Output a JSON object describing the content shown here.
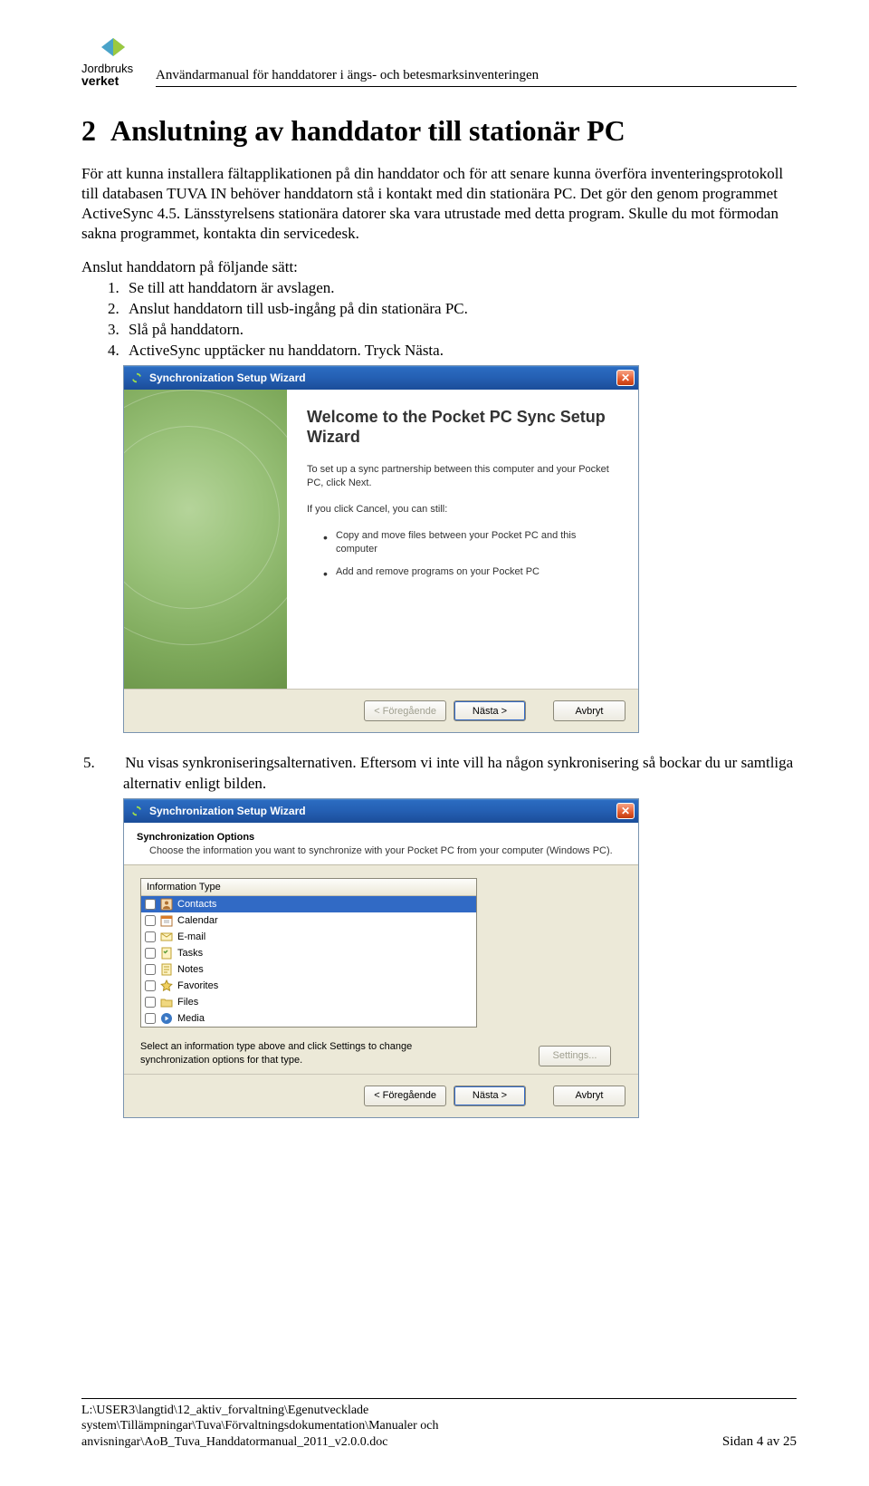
{
  "header": {
    "logo_top": "Jordbruks",
    "logo_bottom": "verket",
    "running_title": "Användarmanual för handdatorer i ängs- och betesmarksinventeringen"
  },
  "section": {
    "number": "2",
    "title": "Anslutning av handdator till stationär PC"
  },
  "intro": "För att kunna installera fältapplikationen på din handdator och för att senare kunna överföra inventeringsprotokoll till databasen TUVA IN behöver handdatorn stå i kontakt med din stationära PC. Det gör den genom programmet ActiveSync 4.5. Länsstyrelsens stationära datorer ska vara utrustade med detta program. Skulle du mot förmodan sakna programmet, kontakta din servicedesk.",
  "list_intro": "Anslut handdatorn på följande sätt:",
  "steps": [
    "Se till att handdatorn är avslagen.",
    "Anslut handdatorn till usb-ingång på din stationära PC.",
    "Slå på handdatorn.",
    "ActiveSync upptäcker nu handdatorn. Tryck Nästa."
  ],
  "wizard1": {
    "title": "Synchronization Setup Wizard",
    "welcome_heading": "Welcome to the Pocket PC Sync Setup Wizard",
    "p1": "To set up a sync partnership between this computer and your Pocket PC, click Next.",
    "p2": "If you click Cancel, you can still:",
    "bullets": [
      "Copy and move files between your Pocket PC and this computer",
      "Add and remove programs on your Pocket PC"
    ],
    "btn_prev": "< Föregående",
    "btn_next": "Nästa >",
    "btn_cancel": "Avbryt"
  },
  "step5_text": "Nu visas synkroniseringsalternativen. Eftersom vi inte vill ha någon synkronisering så bockar du ur samtliga alternativ enligt bilden.",
  "wizard2": {
    "title": "Synchronization Setup Wizard",
    "header_title": "Synchronization Options",
    "header_sub": "Choose the information you want to synchronize with your Pocket PC from your computer (Windows PC).",
    "column": "Information Type",
    "items": [
      {
        "label": "Contacts",
        "icon": "contacts",
        "color": "#d97b2a",
        "selected": true
      },
      {
        "label": "Calendar",
        "icon": "calendar",
        "color": "#d97b2a"
      },
      {
        "label": "E-mail",
        "icon": "mail",
        "color": "#e0c04a"
      },
      {
        "label": "Tasks",
        "icon": "tasks",
        "color": "#e0c04a"
      },
      {
        "label": "Notes",
        "icon": "notes",
        "color": "#e0c04a"
      },
      {
        "label": "Favorites",
        "icon": "star",
        "color": "#5aa24a"
      },
      {
        "label": "Files",
        "icon": "folder",
        "color": "#e0c04a"
      },
      {
        "label": "Media",
        "icon": "media",
        "color": "#3a78c4"
      }
    ],
    "hint": "Select an information type above and click Settings to change synchronization options for that type.",
    "btn_settings": "Settings...",
    "btn_prev": "< Föregående",
    "btn_next": "Nästa >",
    "btn_cancel": "Avbryt"
  },
  "footer": {
    "line1": "L:\\USER3\\langtid\\12_aktiv_forvaltning\\Egenutvecklade",
    "line2": "system\\Tillämpningar\\Tuva\\Förvaltningsdokumentation\\Manualer och",
    "line3": "anvisningar\\AoB_Tuva_Handdatormanual_2011_v2.0.0.doc",
    "page": "Sidan 4 av 25"
  }
}
